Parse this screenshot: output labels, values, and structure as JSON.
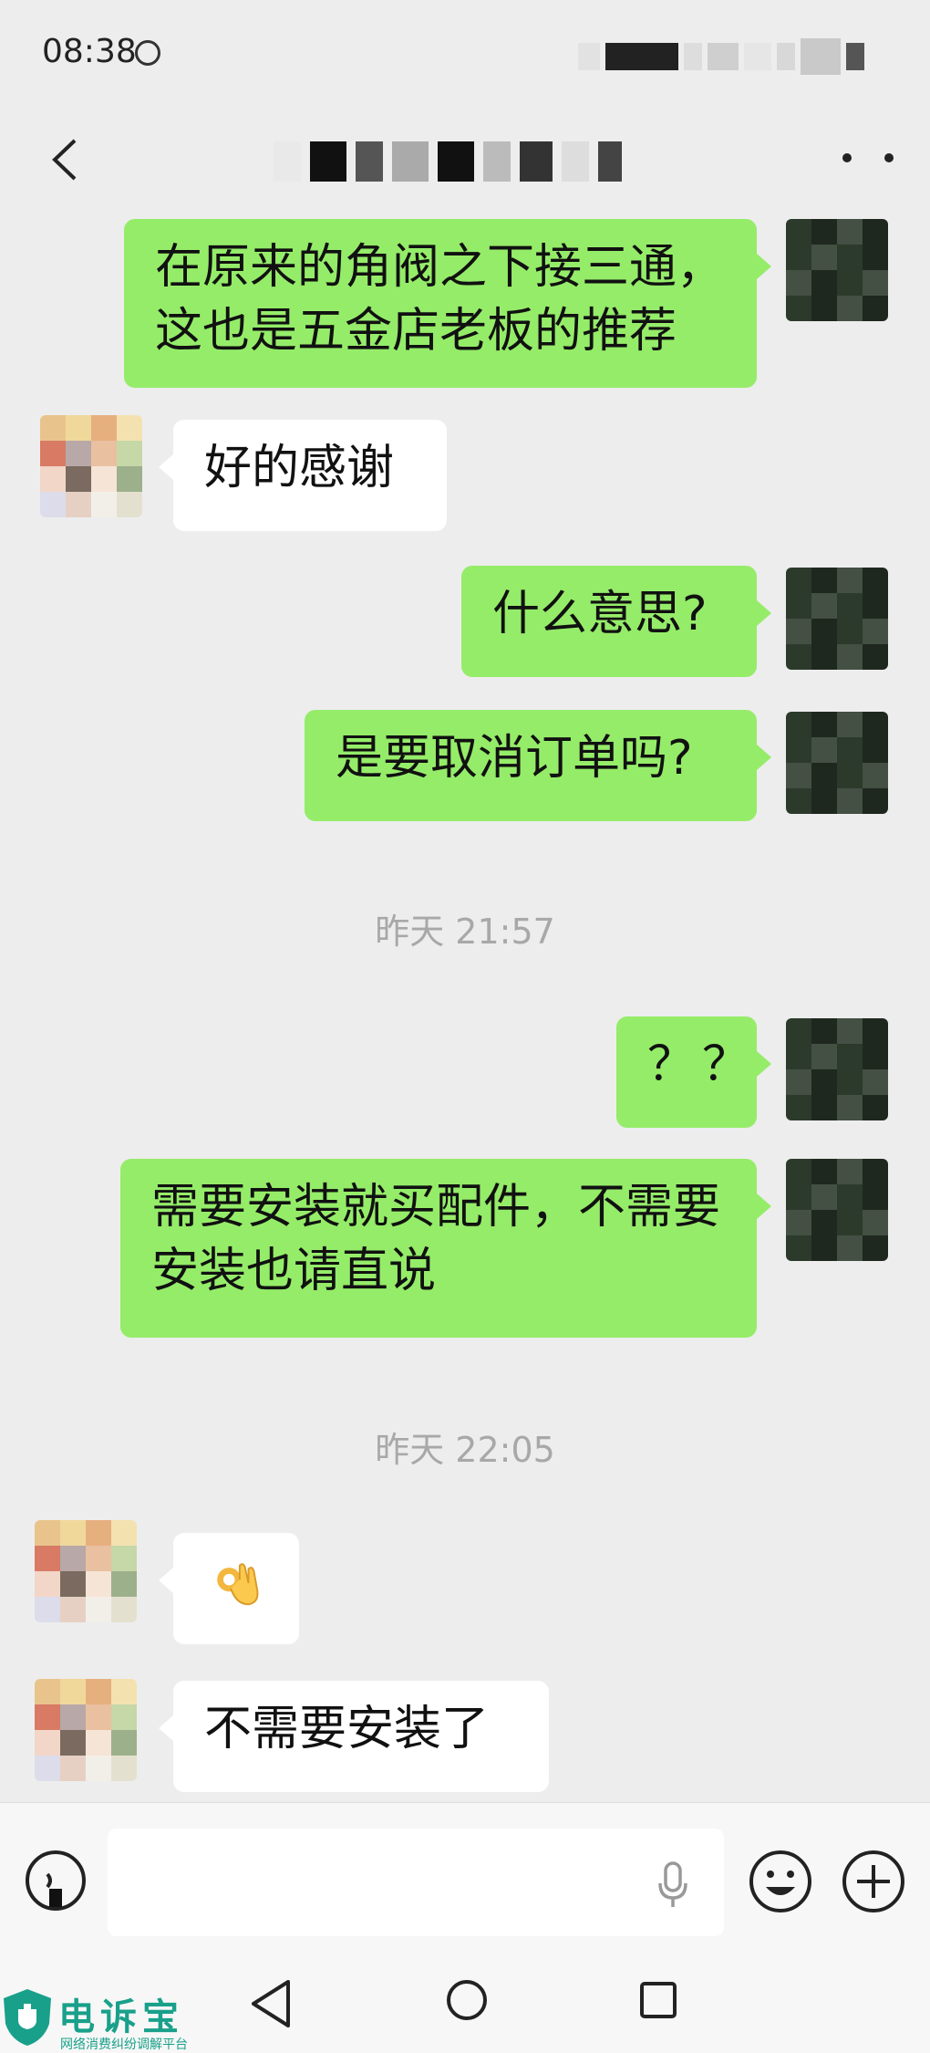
{
  "status_bar": {
    "time": "08:38"
  },
  "messages": [
    {
      "side": "sent",
      "text": "在原来的角阀之下接三通，这也是五金店老板的推荐"
    },
    {
      "side": "recv",
      "text": "好的感谢"
    },
    {
      "side": "sent",
      "text": "什么意思?"
    },
    {
      "side": "sent",
      "text": "是要取消订单吗?"
    },
    {
      "type": "time",
      "text": "昨天 21:57"
    },
    {
      "side": "sent",
      "text": "？？"
    },
    {
      "side": "sent",
      "text": "需要安装就买配件，不需要安装也请直说"
    },
    {
      "type": "time",
      "text": "昨天 22:05"
    },
    {
      "side": "recv",
      "icon": "ok-hand-emoji-icon"
    },
    {
      "side": "recv",
      "text": "不需要安装了"
    }
  ],
  "watermark": {
    "title": "电诉宝",
    "subtitle": "网络消费纠纷调解平台"
  },
  "colors": {
    "sent_bubble": "#95ec69",
    "recv_bubble": "#ffffff",
    "background": "#ededed",
    "watermark": "#19a08a"
  }
}
